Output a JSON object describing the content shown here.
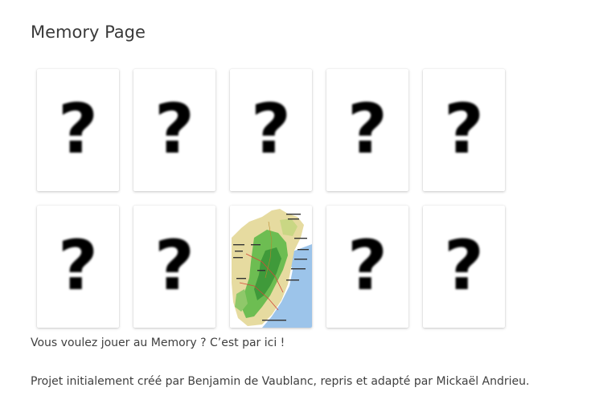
{
  "page": {
    "title": "Memory Page"
  },
  "board": {
    "rows": 2,
    "columns": 5,
    "cards": [
      {
        "state": "face-down",
        "symbol": "?",
        "icon": "question-mark-icon"
      },
      {
        "state": "face-down",
        "symbol": "?",
        "icon": "question-mark-icon"
      },
      {
        "state": "face-down",
        "symbol": "?",
        "icon": "question-mark-icon"
      },
      {
        "state": "face-down",
        "symbol": "?",
        "icon": "question-mark-icon"
      },
      {
        "state": "face-down",
        "symbol": "?",
        "icon": "question-mark-icon"
      },
      {
        "state": "face-down",
        "symbol": "?",
        "icon": "question-mark-icon"
      },
      {
        "state": "face-down",
        "symbol": "?",
        "icon": "question-mark-icon"
      },
      {
        "state": "face-up",
        "image": "map-image"
      },
      {
        "state": "face-down",
        "symbol": "?",
        "icon": "question-mark-icon"
      },
      {
        "state": "face-down",
        "symbol": "?",
        "icon": "question-mark-icon"
      }
    ]
  },
  "content": {
    "intro": "Vous voulez jouer au Memory ? C’est par ici !",
    "credits": "Projet initialement créé par Benjamin de Vaublanc, repris et adapté par Mickaël Andrieu."
  },
  "colors": {
    "text": "#404040",
    "card_background": "#ffffff",
    "map_sea": "#9cc4ea",
    "map_land": "#e6dba0",
    "map_green": "#4fae44"
  }
}
